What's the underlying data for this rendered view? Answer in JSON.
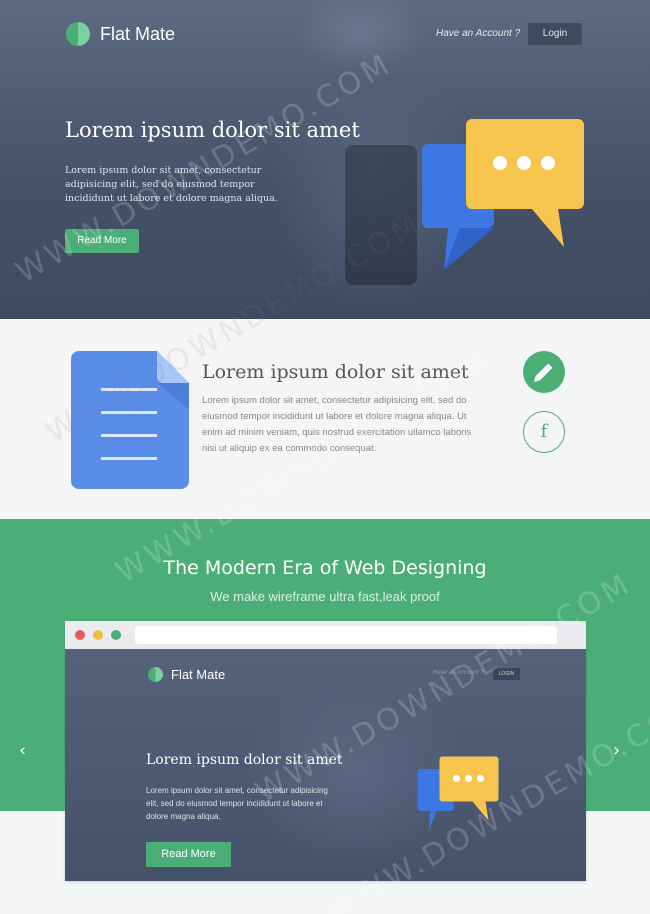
{
  "hero": {
    "brand": "Flat Mate",
    "have_account": "Have an Account ?",
    "login": "Login",
    "title": "Lorem ipsum dolor sit amet",
    "description": "Lorem ipsum dolor sit amet, consectetur adipisicing elit, sed do eiusmod tempor incididunt ut labore et dolore magna aliqua.",
    "read_more": "Read More"
  },
  "feature": {
    "title": "Lorem ipsum dolor sit amet",
    "text": "Lorem ipsum dolor sit amet, consectetur adipisicing elit, sed do eiusmod tempor incididunt ut labore et dolore magna aliqua. Ut enim ad minim veniam, quis nostrud exercitation ullamco laboris nisi ut aliquip ex ea commodo consequat.",
    "facebook_glyph": "f"
  },
  "showcase": {
    "title": "The Modern Era of Web Designing",
    "subtitle": "We make wireframe ultra fast,leak proof",
    "prev_arrow": "‹",
    "next_arrow": "›",
    "preview": {
      "brand": "Flat Mate",
      "have_account": "Have an Account ?",
      "login": "LOGIN",
      "title": "Lorem ipsum dolor sit amet",
      "description": "Lorem ipsum dolor sit amet, consectetur adipisicing elit, sed do eiusmod tempor incididunt ut labore et dolore magna aliqua.",
      "read_more": "Read More"
    }
  },
  "watermark": "WWW.DOWNDEMO.COM",
  "colors": {
    "accent": "#4cae77",
    "chat_blue": "#3d78e2",
    "chat_yellow": "#f7c54d",
    "doc_blue": "#5a8de8",
    "hero_bg": "#4a566c"
  },
  "icons": {
    "logo": "half-circle-logo-icon",
    "chat": "chat-bubbles-icon",
    "document": "document-icon",
    "pencil": "pencil-icon",
    "facebook": "facebook-icon",
    "prev": "chevron-left-icon",
    "next": "chevron-right-icon"
  }
}
